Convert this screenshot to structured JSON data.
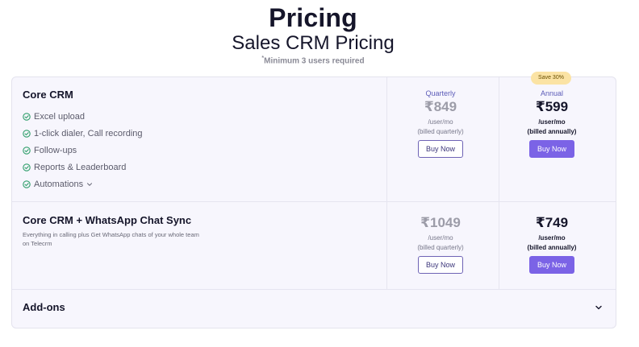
{
  "header": {
    "title": "Pricing",
    "subtitle": "Sales CRM Pricing",
    "note_marker": "*",
    "note": "Minimum 3 users required"
  },
  "colors": {
    "accent": "#7b63e6",
    "check_green": "#2e9e6a",
    "badge_bg": "#fbe3a4",
    "card_bg": "#f7f6fd"
  },
  "plans": [
    {
      "title": "Core CRM",
      "features": [
        {
          "label": "Excel upload",
          "icon": "check-circle-icon"
        },
        {
          "label": "1-click dialer, Call recording",
          "icon": "check-circle-icon"
        },
        {
          "label": "Follow-ups",
          "icon": "check-circle-icon"
        },
        {
          "label": "Reports & Leaderboard",
          "icon": "check-circle-icon"
        },
        {
          "label": "Automations",
          "icon": "check-circle-icon",
          "expandable": true
        }
      ],
      "quarterly": {
        "label": "Quarterly",
        "price": "₹849",
        "unit": "/user/mo",
        "billing": "(billed quarterly)",
        "button": "Buy Now"
      },
      "annual": {
        "label": "Annual",
        "badge": "Save 30%",
        "price": "₹599",
        "unit": "/user/mo",
        "billing": "(billed annually)",
        "button": "Buy Now"
      }
    },
    {
      "title": "Core CRM + WhatsApp Chat Sync",
      "description": "Everything in calling plus Get WhatsApp chats of your whole team on Telecrm",
      "quarterly": {
        "price": "₹1049",
        "unit": "/user/mo",
        "billing": "(billed quarterly)",
        "button": "Buy Now"
      },
      "annual": {
        "price": "₹749",
        "unit": "/user/mo",
        "billing": "(billed annually)",
        "button": "Buy Now"
      }
    }
  ],
  "addons": {
    "label": "Add-ons",
    "icon": "chevron-down-icon"
  }
}
